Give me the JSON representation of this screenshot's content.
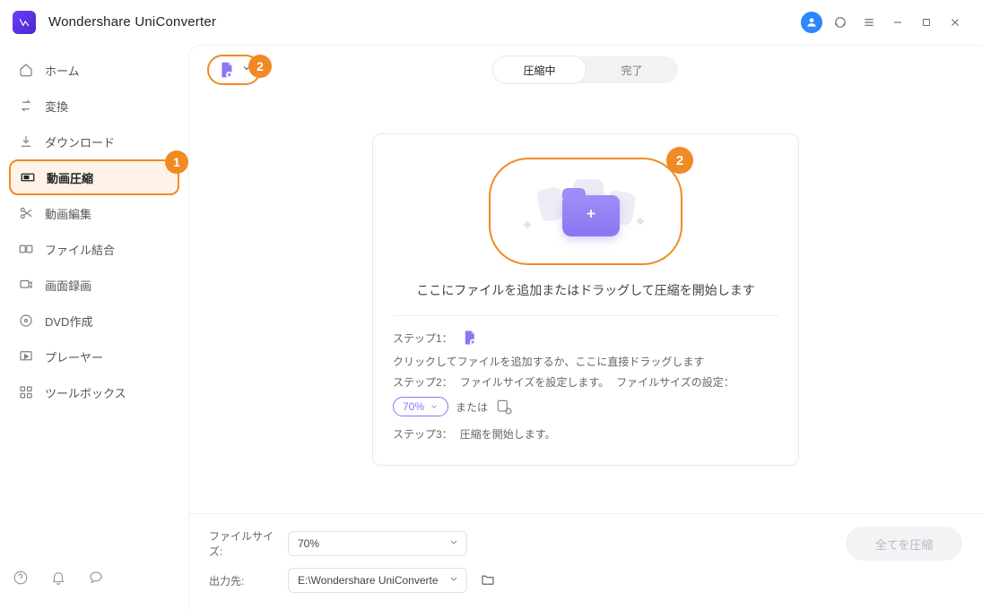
{
  "app": {
    "title": "Wondershare UniConverter"
  },
  "sidebar": {
    "items": [
      {
        "label": "ホーム"
      },
      {
        "label": "変換"
      },
      {
        "label": "ダウンロード"
      },
      {
        "label": "動画圧縮"
      },
      {
        "label": "動画編集"
      },
      {
        "label": "ファイル結合"
      },
      {
        "label": "画面録画"
      },
      {
        "label": "DVD作成"
      },
      {
        "label": "プレーヤー"
      },
      {
        "label": "ツールボックス"
      }
    ],
    "active_index": 3,
    "active_badge": "1"
  },
  "toolbar": {
    "add_badge": "2",
    "tabs": {
      "active": "圧縮中",
      "done": "完了"
    }
  },
  "drop": {
    "zone_badge": "2",
    "caption": "ここにファイルを追加またはドラッグして圧縮を開始します"
  },
  "steps": {
    "step1_label": "ステップ1：",
    "step1_text": "クリックしてファイルを追加するか、ここに直接ドラッグします",
    "step2_label": "ステップ2：",
    "step2_text_a": "ファイルサイズを設定します。",
    "step2_text_b": "ファイルサイズの設定：",
    "size_percent": "70%",
    "or": "または",
    "step3_label": "ステップ3：",
    "step3_text": "圧縮を開始します。"
  },
  "footer": {
    "size_label": "ファイルサイズ:",
    "size_value": "70%",
    "output_label": "出力先:",
    "output_value": "E:\\Wondershare UniConverte",
    "action": "全てを圧縮"
  }
}
